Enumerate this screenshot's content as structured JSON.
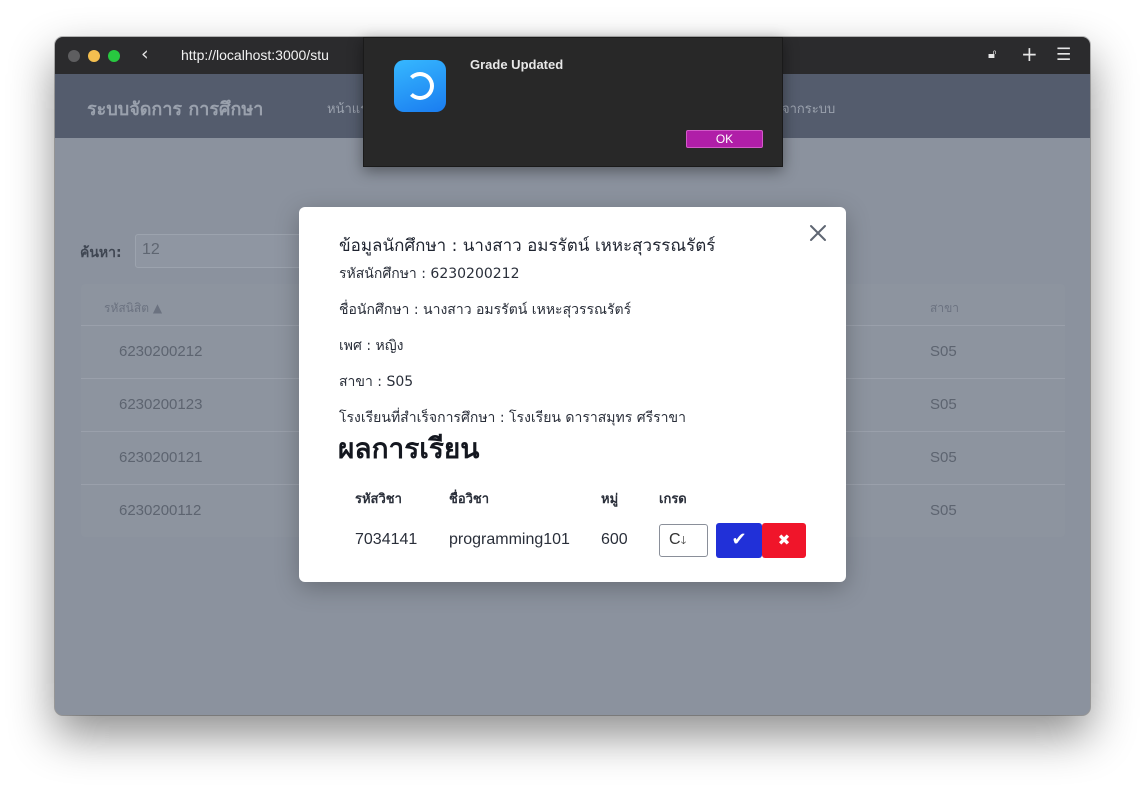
{
  "browser": {
    "url": "http://localhost:3000/stu",
    "back_icon": "chevron-left-icon",
    "lock_icon": "lock-icon",
    "plus_icon": "plus-icon",
    "menu_icon": "hamburger-menu-icon"
  },
  "navbar": {
    "brand": "ระบบจัดการ การศึกษา",
    "home": "หน้าแร",
    "logout": "จากระบบ"
  },
  "search": {
    "label": "ค้นหา:",
    "value": "12"
  },
  "table": {
    "headers": {
      "id": "รหัสนิสิต ▲",
      "branch": "สาขา"
    },
    "rows": [
      {
        "id": "6230200212",
        "branch": "S05"
      },
      {
        "id": "6230200123",
        "branch": "S05"
      },
      {
        "id": "6230200121",
        "branch": "S05"
      },
      {
        "id": "6230200112",
        "branch": "S05"
      }
    ]
  },
  "notification": {
    "title": "Grade Updated",
    "ok_label": "OK"
  },
  "modal": {
    "title": "ข้อมูลนักศึกษา : นางสาว อมรรัตน์ เหหะสุวรรณรัตร์",
    "student_id_line": "รหัสนักศึกษา : 6230200212",
    "name_line": "ชื่อนักศึกษา : นางสาว อมรรัตน์ เหหะสุวรรณรัตร์",
    "gender_line": "เพศ : หญิง",
    "branch_line": "สาขา : S05",
    "school_line": "โรงเรียนที่สำเร็จการศึกษา : โรงเรียน ดาราสมุทร ศรีราขา",
    "results_heading": "ผลการเรียน",
    "grades": {
      "headers": {
        "code": "รหัสวิชา",
        "name": "ชื่อวิชา",
        "section": "หมู่",
        "grade": "เกรด"
      },
      "rows": [
        {
          "code": "7034141",
          "name": "programming101",
          "section": "600",
          "grade": "C"
        }
      ]
    },
    "confirm_label": "✔",
    "cancel_label": "✖"
  },
  "colors": {
    "confirm": "#2130d8",
    "cancel": "#f0152a",
    "ok_button": "#b01ea8"
  }
}
